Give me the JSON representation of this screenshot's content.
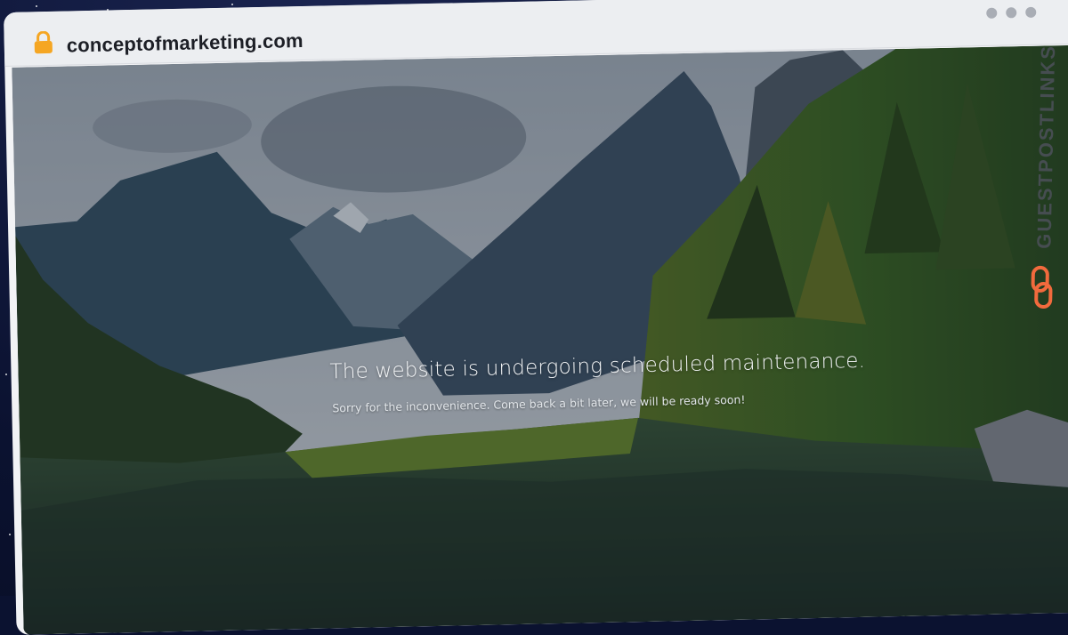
{
  "browser": {
    "url": "conceptofmarketing.com",
    "icons": {
      "lock": "lock-icon",
      "window_controls": "three-dots-icon"
    },
    "colors": {
      "lock": "#f5a623",
      "titlebar": "#eceef1"
    }
  },
  "page": {
    "heading": "The website is undergoing scheduled maintenance.",
    "subtext": "Sorry for the inconvenience. Come back a bit later, we will be ready soon!"
  },
  "watermark": {
    "text": "GUESTPOSTLINKS",
    "icon": "chain-link-icon",
    "color": "#f26a3d"
  }
}
